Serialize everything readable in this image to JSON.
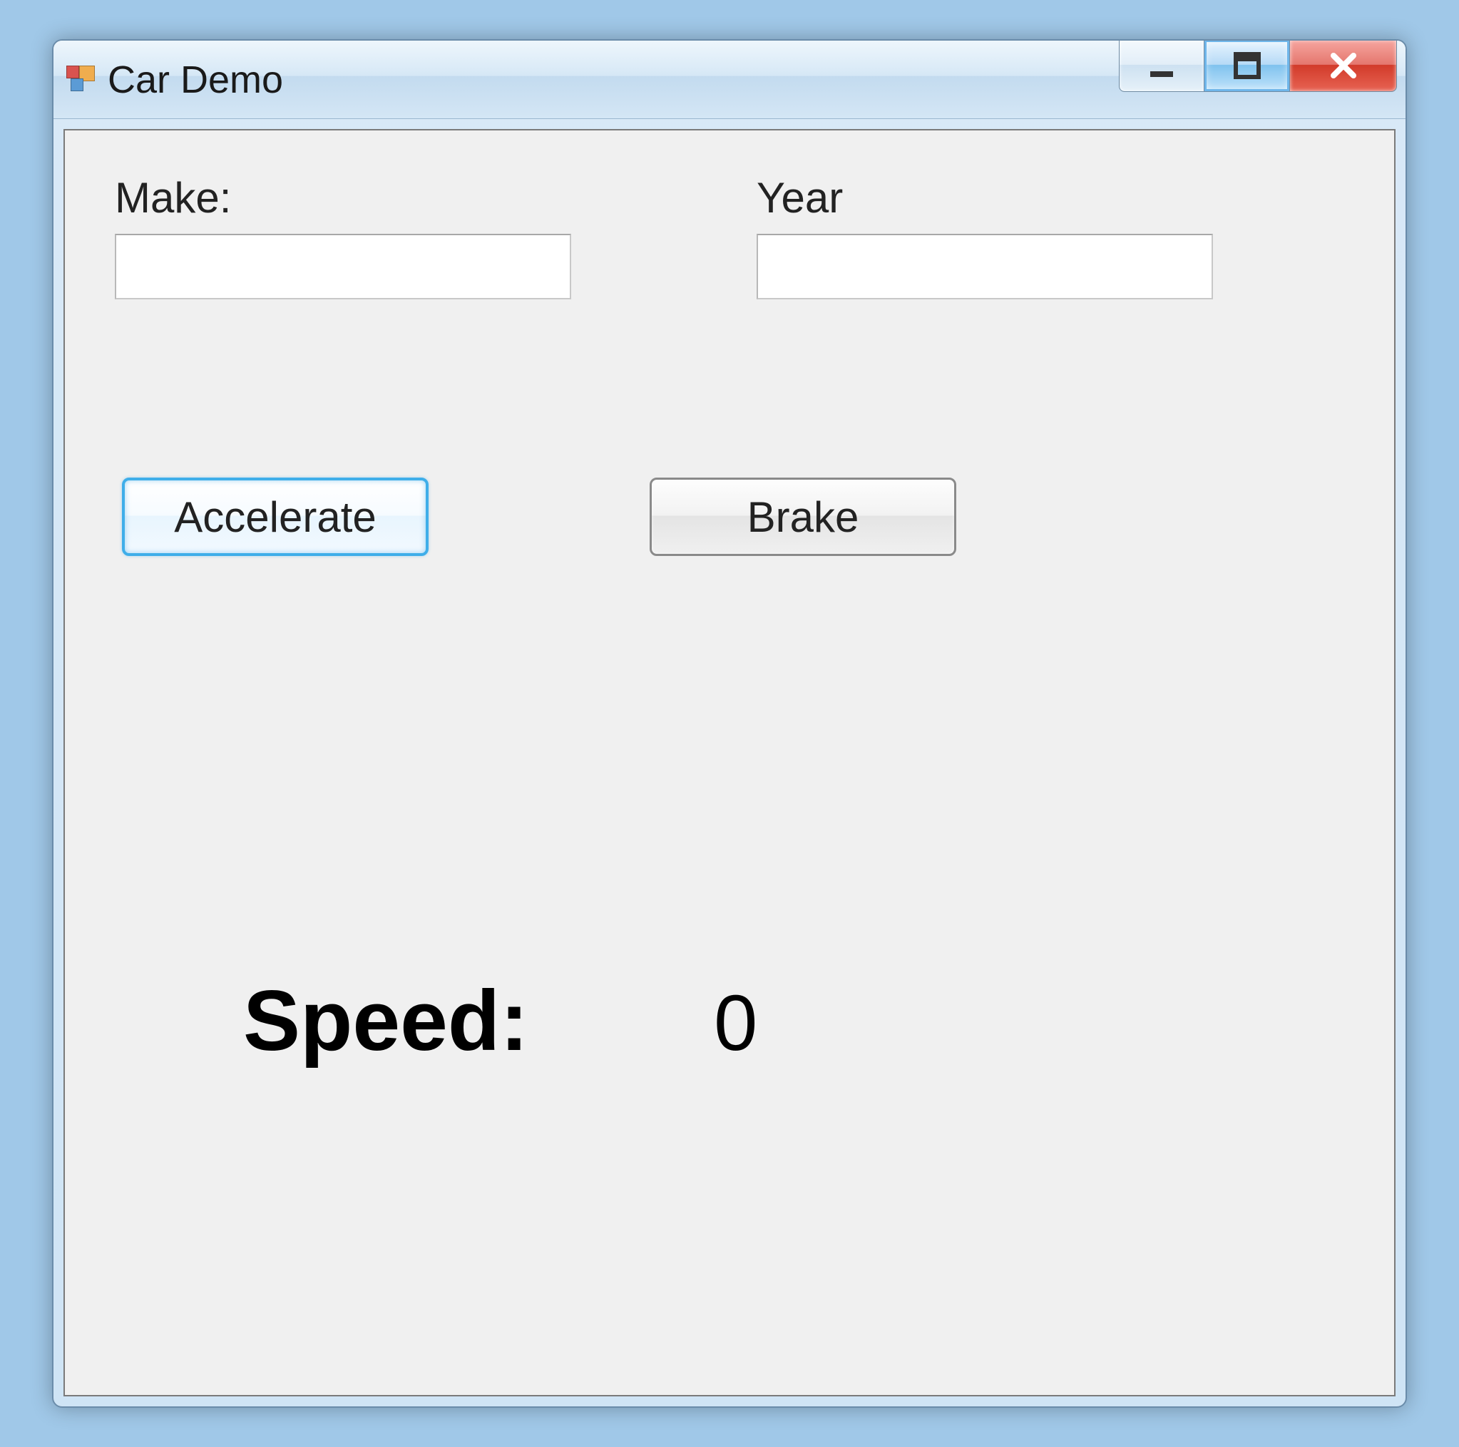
{
  "window": {
    "title": "Car Demo"
  },
  "form": {
    "make": {
      "label": "Make:",
      "value": ""
    },
    "year": {
      "label": "Year",
      "value": ""
    }
  },
  "buttons": {
    "accelerate": "Accelerate",
    "brake": "Brake"
  },
  "speed": {
    "label": "Speed:",
    "value": "0"
  }
}
